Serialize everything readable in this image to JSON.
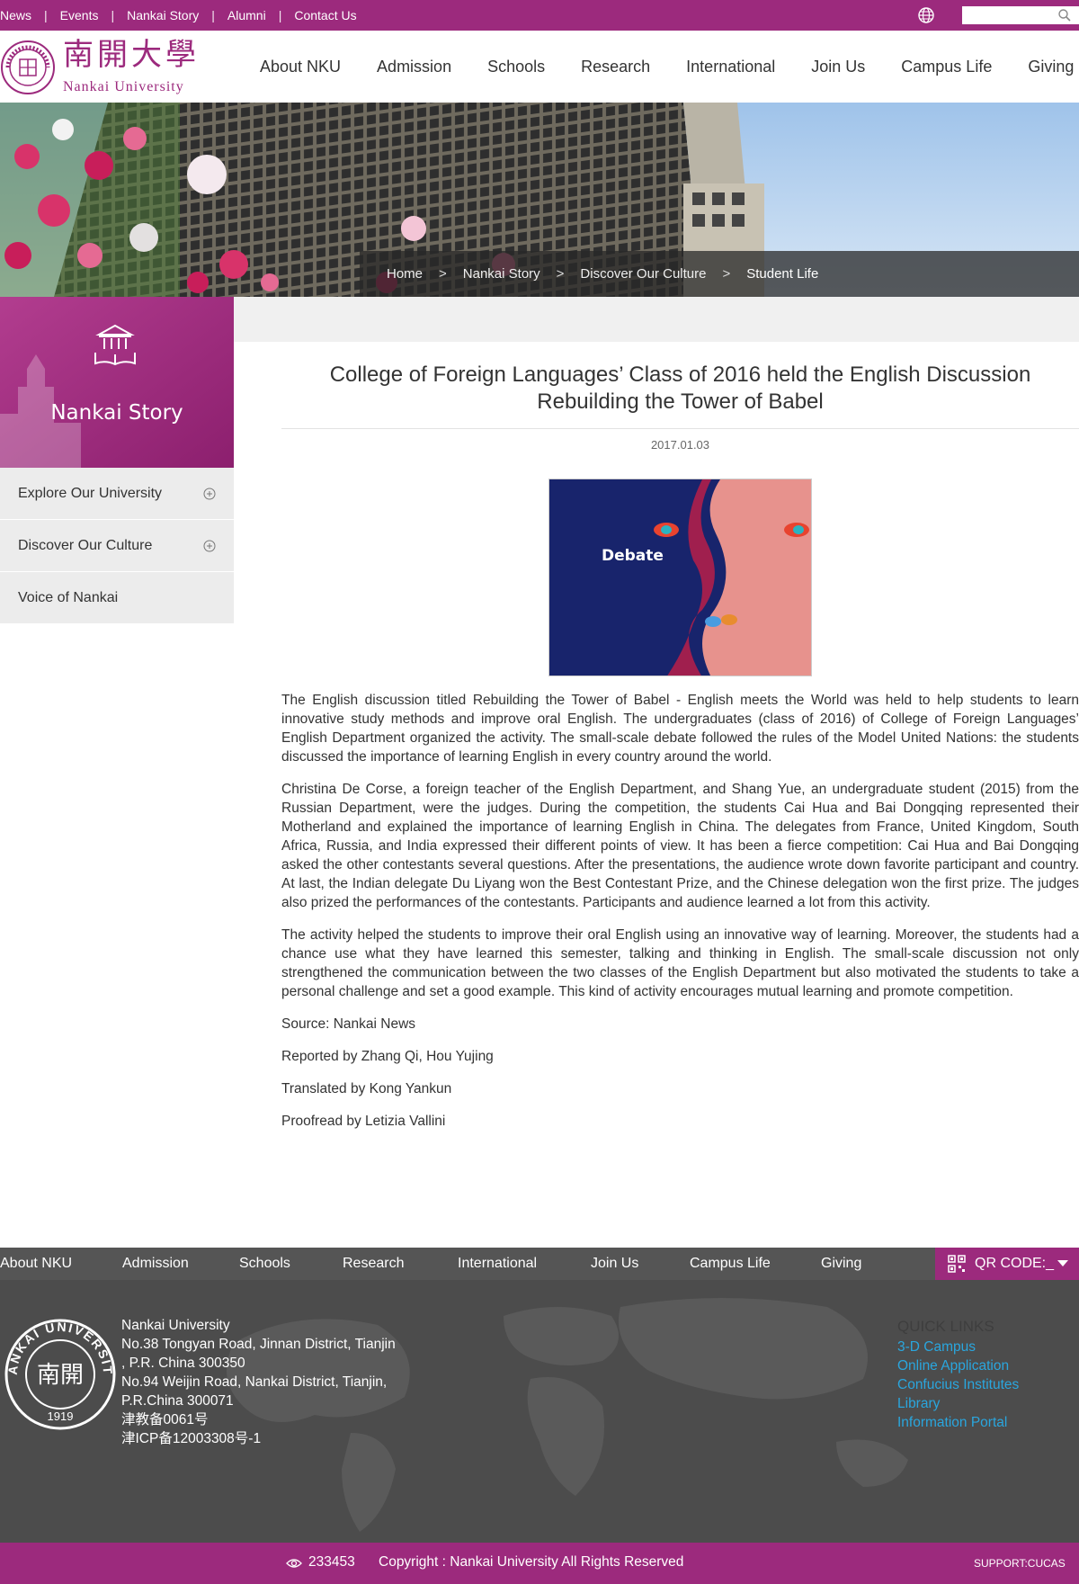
{
  "topbar": {
    "links": [
      "News",
      "Events",
      "Nankai Story",
      "Alumni",
      "Contact Us"
    ],
    "search_placeholder": ""
  },
  "brand": {
    "chinese_name": "南開大學",
    "english_name": "Nankai University",
    "seal_top": "NANKAI UNIVERSITY",
    "seal_center": "南開",
    "seal_year": "1919",
    "color": "#9c2a7d"
  },
  "mainnav": [
    "About NKU",
    "Admission",
    "Schools",
    "Research",
    "International",
    "Join Us",
    "Campus Life",
    "Giving"
  ],
  "breadcrumb": {
    "items": [
      "Home",
      "Nankai Story",
      "Discover Our Culture",
      "Student Life"
    ],
    "separator": ">"
  },
  "sidebar": {
    "title": "Nankai Story",
    "items": [
      {
        "label": "Explore Our University",
        "expandable": true
      },
      {
        "label": "Discover Our Culture",
        "expandable": true
      },
      {
        "label": "Voice of Nankai",
        "expandable": false
      }
    ]
  },
  "article": {
    "title": "College of Foreign Languages’ Class of 2016 held the English Discussion Rebuilding the Tower of Babel",
    "date": "2017.01.03",
    "image_text": "Debate",
    "paragraphs": [
      "The English discussion titled Rebuilding the Tower of Babel - English meets the World was held to help students to learn innovative study methods and improve oral English. The undergraduates (class of 2016) of College of Foreign Languages’ English Department organized the activity. The small-scale debate followed the rules of the Model United Nations: the students discussed the importance of learning English in every country around the world.",
      "Christina De Corse, a foreign teacher of the English Department, and Shang Yue, an undergraduate student (2015) from the Russian Department, were the judges. During the competition, the students Cai Hua and Bai Dongqing represented their Motherland and explained the importance of learning English in China. The delegates from France, United Kingdom, South Africa, Russia, and India expressed their different points of view. It has been a fierce competition: Cai Hua and Bai Dongqing asked the other contestants several questions. After the presentations, the audience wrote down favorite participant and country. At last, the Indian delegate Du Liyang won the Best Contestant Prize, and the Chinese delegation won the first prize. The judges also prized the performances of the contestants. Participants and audience learned a lot from this activity.",
      "The activity helped the students to improve their oral English using an innovative way of learning. Moreover, the students had a chance use what they have learned this semester, talking and thinking in English. The small-scale discussion not only strengthened the communication between the two classes of the English Department but also motivated the students to take a personal challenge and set a good example. This kind of activity encourages mutual learning and promote competition.",
      "Source: Nankai News",
      "Reported by Zhang Qi, Hou Yujing",
      "Translated by Kong Yankun",
      "Proofread by Letizia Vallini"
    ]
  },
  "footer": {
    "nav": [
      "About NKU",
      "Admission",
      "Schools",
      "Research",
      "International",
      "Join Us",
      "Campus Life",
      "Giving"
    ],
    "qr_label": "QR CODE:_",
    "address_lines": [
      "Nankai University",
      "No.38 Tongyan Road, Jinnan District, Tianjin",
      ", P.R. China 300350",
      "No.94 Weijin Road,  Nankai District, Tianjin,",
      "P.R.China  300071",
      "津教备0061号",
      "津ICP备12003308号-1"
    ],
    "quick_links_title": "QUICK LINKS",
    "quick_links": [
      "3-D Campus",
      "Online Application",
      "Confucius Institutes",
      "Library",
      "Information Portal"
    ],
    "visits": "233453",
    "copyright": "Copyright : Nankai University All Rights Reserved",
    "support": "SUPPORT:CUCAS"
  }
}
